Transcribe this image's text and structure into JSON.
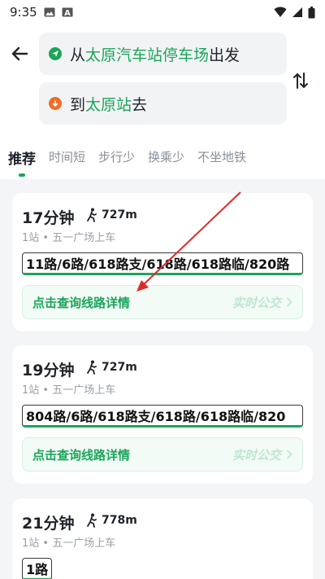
{
  "status_bar": {
    "time": "9:35"
  },
  "header": {
    "from_prefix": "从",
    "from_station": "太原汽车站停车场",
    "from_suffix": "出发",
    "to_prefix": "到",
    "to_station": "太原站",
    "to_suffix": "去"
  },
  "tabs": [
    {
      "label": "推荐",
      "active": true
    },
    {
      "label": "时间短",
      "active": false
    },
    {
      "label": "步行少",
      "active": false
    },
    {
      "label": "换乘少",
      "active": false
    },
    {
      "label": "不坐地铁",
      "active": false
    }
  ],
  "routes": [
    {
      "duration": "17分钟",
      "walk": "727m",
      "sub": "1站 • 五一广场上车",
      "lines": "11路/6路/618路支/618路/618路临/820路",
      "detail_label": "点击查询线路详情",
      "realtime_label": "实时公交"
    },
    {
      "duration": "19分钟",
      "walk": "727m",
      "sub": "1站 • 五一广场上车",
      "lines": "804路/6路/618路支/618路/618路临/820",
      "detail_label": "点击查询线路详情",
      "realtime_label": "实时公交"
    },
    {
      "duration": "21分钟",
      "walk": "778m",
      "sub": "1站 • 五一广场上车",
      "lines": "1路"
    }
  ],
  "colors": {
    "accent": "#1aa659",
    "origin_dot": "#1aa659",
    "destination_dot": "#f06d24",
    "annotation_arrow": "#e02b2b"
  }
}
